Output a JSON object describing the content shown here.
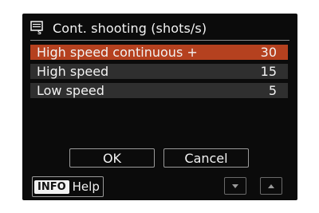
{
  "screen": {
    "title": "Cont. shooting (shots/s)",
    "title_icon": "continuous-shooting-icon"
  },
  "options": [
    {
      "label": "High speed continuous +",
      "value": "30",
      "selected": true
    },
    {
      "label": "High speed",
      "value": "15",
      "selected": false
    },
    {
      "label": "Low speed",
      "value": "5",
      "selected": false
    }
  ],
  "buttons": {
    "ok": "OK",
    "cancel": "Cancel"
  },
  "help": {
    "badge": "INFO",
    "label": "Help"
  },
  "nav": {
    "down_icon": "chevron-down-icon",
    "up_icon": "chevron-up-icon"
  },
  "colors": {
    "selected": "#b5411f",
    "row": "#2f2f2f",
    "background": "#0b0b0b"
  }
}
